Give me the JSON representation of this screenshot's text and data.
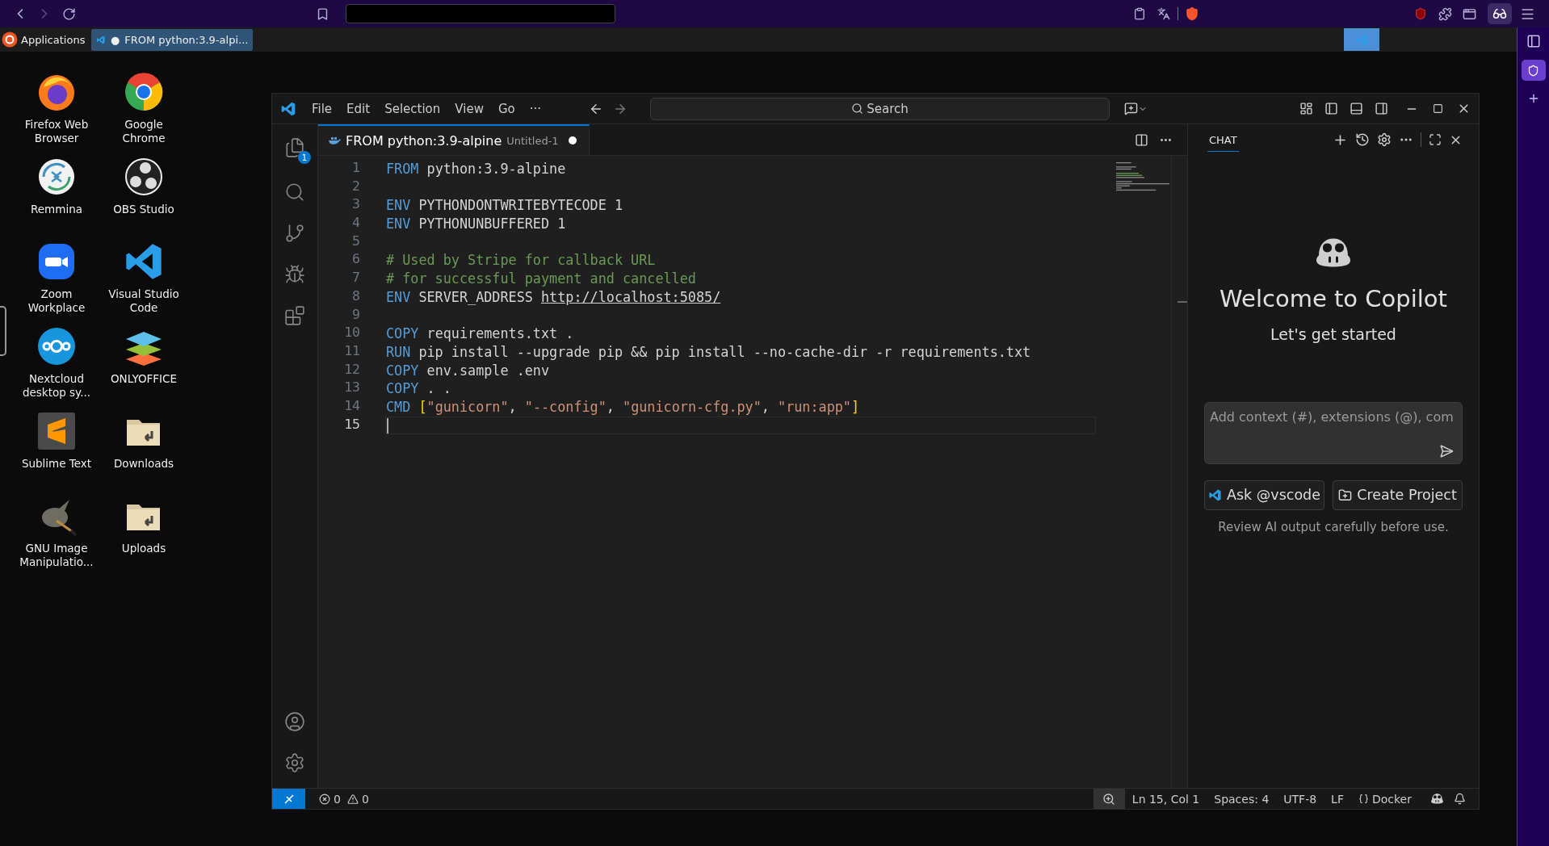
{
  "taskbar": {
    "menu": "Applications",
    "tasks": [
      {
        "mark": "●",
        "title": "FROM python:3.9-alpi...",
        "selected": true
      }
    ],
    "workspaces": [
      {
        "selected": true
      }
    ]
  },
  "desktop": {
    "icons": [
      {
        "kind": "firefox",
        "label": [
          "Firefox Web",
          "Browser"
        ]
      },
      {
        "kind": "chrome",
        "label": [
          "Google",
          "Chrome"
        ]
      },
      {
        "kind": "remmina",
        "label": [
          "Remmina"
        ]
      },
      {
        "kind": "obs",
        "label": [
          "OBS Studio"
        ]
      },
      {
        "kind": "zoom",
        "label": [
          "Zoom",
          "Workplace"
        ]
      },
      {
        "kind": "vscode",
        "label": [
          "Visual Studio",
          "Code"
        ]
      },
      {
        "kind": "nextcloud",
        "label": [
          "Nextcloud",
          "desktop sy..."
        ]
      },
      {
        "kind": "onlyoffice",
        "label": [
          "ONLYOFFICE"
        ]
      },
      {
        "kind": "sublime",
        "label": [
          "Sublime Text"
        ]
      },
      {
        "kind": "folder",
        "label": [
          "Downloads"
        ]
      },
      {
        "kind": "gimp",
        "label": [
          "GNU Image",
          "Manipulatio..."
        ]
      },
      {
        "kind": "folder",
        "label": [
          "Uploads"
        ]
      }
    ]
  },
  "vscode": {
    "menu": [
      "File",
      "Edit",
      "Selection",
      "View",
      "Go",
      "···"
    ],
    "search": {
      "placeholder": "Search"
    },
    "explorer_badge": "1",
    "tab": {
      "title": "FROM python:3.9-alpine",
      "description": "Untitled-1",
      "dirty": true,
      "selected": true
    },
    "lines": [
      {
        "number": "1",
        "current": false,
        "tokens": [
          {
            "text": "FROM",
            "kind": "keyword"
          },
          {
            "text": " python:3.9-alpine",
            "kind": "plain"
          }
        ]
      },
      {
        "number": "2",
        "current": false
      },
      {
        "number": "3",
        "current": false,
        "tokens": [
          {
            "text": "ENV",
            "kind": "keyword"
          },
          {
            "text": " PYTHONDONTWRITEBYTECODE 1",
            "kind": "plain"
          }
        ]
      },
      {
        "number": "4",
        "current": false,
        "tokens": [
          {
            "text": "ENV",
            "kind": "keyword"
          },
          {
            "text": " PYTHONUNBUFFERED 1",
            "kind": "plain"
          }
        ]
      },
      {
        "number": "5",
        "current": false
      },
      {
        "number": "6",
        "current": false,
        "tokens": [
          {
            "text": "# Used by Stripe for callback URL",
            "kind": "comment"
          }
        ]
      },
      {
        "number": "7",
        "current": false,
        "tokens": [
          {
            "text": "# for successful payment and cancelled",
            "kind": "comment"
          }
        ]
      },
      {
        "number": "8",
        "current": false,
        "tokens": [
          {
            "text": "ENV",
            "kind": "keyword"
          },
          {
            "text": " SERVER_ADDRESS ",
            "kind": "plain"
          },
          {
            "text": "http://localhost:5085/",
            "kind": "link"
          }
        ]
      },
      {
        "number": "9",
        "current": false
      },
      {
        "number": "10",
        "current": false,
        "tokens": [
          {
            "text": "COPY",
            "kind": "keyword"
          },
          {
            "text": " requirements.txt .",
            "kind": "plain"
          }
        ]
      },
      {
        "number": "11",
        "current": false,
        "tokens": [
          {
            "text": "RUN",
            "kind": "keyword"
          },
          {
            "text": " pip install --upgrade pip && pip install --no-cache-dir -r requirements.txt",
            "kind": "plain"
          }
        ]
      },
      {
        "number": "12",
        "current": false,
        "tokens": [
          {
            "text": "COPY",
            "kind": "keyword"
          },
          {
            "text": " env.sample .env",
            "kind": "plain"
          }
        ]
      },
      {
        "number": "13",
        "current": false,
        "tokens": [
          {
            "text": "COPY",
            "kind": "keyword"
          },
          {
            "text": " . .",
            "kind": "plain"
          }
        ]
      },
      {
        "number": "14",
        "current": false,
        "tokens": [
          {
            "text": "CMD",
            "kind": "keyword"
          },
          {
            "text": " [",
            "kind": "bracket"
          },
          {
            "text": "\"gunicorn\"",
            "kind": "string"
          },
          {
            "text": ", ",
            "kind": "plain"
          },
          {
            "text": "\"--config\"",
            "kind": "string"
          },
          {
            "text": ", ",
            "kind": "plain"
          },
          {
            "text": "\"gunicorn-cfg.py\"",
            "kind": "string"
          },
          {
            "text": ", ",
            "kind": "plain"
          },
          {
            "text": "\"run:app\"",
            "kind": "string"
          },
          {
            "text": "]",
            "kind": "bracket"
          }
        ]
      },
      {
        "number": "15",
        "current": true
      }
    ],
    "chat": {
      "tab": {
        "label": "CHAT",
        "selected": true
      },
      "heading": "Welcome to Copilot",
      "subtitle": "Let's get started",
      "input": {
        "placeholder": "Add context (#), extensions (@), com"
      },
      "buttons": [
        {
          "kind": "vscode",
          "label": "Ask @vscode"
        },
        {
          "kind": "project",
          "label": "Create Project"
        }
      ],
      "note": "Review AI output carefully before use."
    },
    "status": {
      "errors": "0",
      "warnings": "0",
      "items": [
        {
          "kind": "text",
          "label": "Ln 15, Col 1"
        },
        {
          "kind": "text",
          "label": "Spaces: 4"
        },
        {
          "kind": "text",
          "label": "UTF-8"
        },
        {
          "kind": "text",
          "label": "LF"
        },
        {
          "kind": "braces",
          "label": "Docker"
        }
      ]
    }
  }
}
